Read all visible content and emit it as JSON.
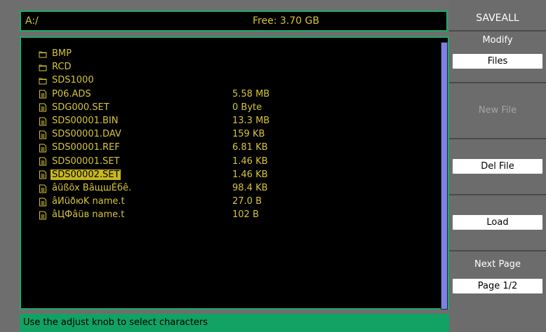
{
  "topbar": {
    "path": "A:/",
    "free": "Free:  3.70 GB"
  },
  "files": [
    {
      "name": "BMP",
      "size": "",
      "type": "folder"
    },
    {
      "name": "RCD",
      "size": "",
      "type": "folder"
    },
    {
      "name": "SDS1000",
      "size": "",
      "type": "folder"
    },
    {
      "name": "P06.ADS",
      "size": "5.58 MB",
      "type": "file"
    },
    {
      "name": "SDG000.SET",
      "size": "0 Byte",
      "type": "file"
    },
    {
      "name": "SDS00001.BIN",
      "size": "13.3 MB",
      "type": "file"
    },
    {
      "name": "SDS00001.DAV",
      "size": "159 KB",
      "type": "file"
    },
    {
      "name": "SDS00001.REF",
      "size": "6.81 KB",
      "type": "file"
    },
    {
      "name": "SDS00001.SET",
      "size": "1.46 KB",
      "type": "file"
    },
    {
      "name": "SDS00002.SET",
      "size": "1.46 KB",
      "type": "file",
      "selected": true
    },
    {
      "name": "âüßõx BâщшÉбê.",
      "size": "98.4 KB",
      "type": "file"
    },
    {
      "name": "âИüðюK name.t",
      "size": "27.0 B",
      "type": "file"
    },
    {
      "name": "âЦФâüв name.t",
      "size": "102 B",
      "type": "file"
    }
  ],
  "status": "Use the adjust knob to select characters",
  "menu": {
    "title": "SAVEALL",
    "modify_label": "Modify",
    "modify_value": "Files",
    "new_file": "New File",
    "del_file": "Del File",
    "load": "Load",
    "next_page_label": "Next Page",
    "next_page_value": "Page 1/2"
  },
  "colors": {
    "text": "#d6c43a",
    "border": "#1aaa6b",
    "selection": "#c8b71f",
    "scrollbar": "#7f7fe8",
    "status_bg": "#12a263",
    "panel_bg": "#6e6e6e"
  }
}
